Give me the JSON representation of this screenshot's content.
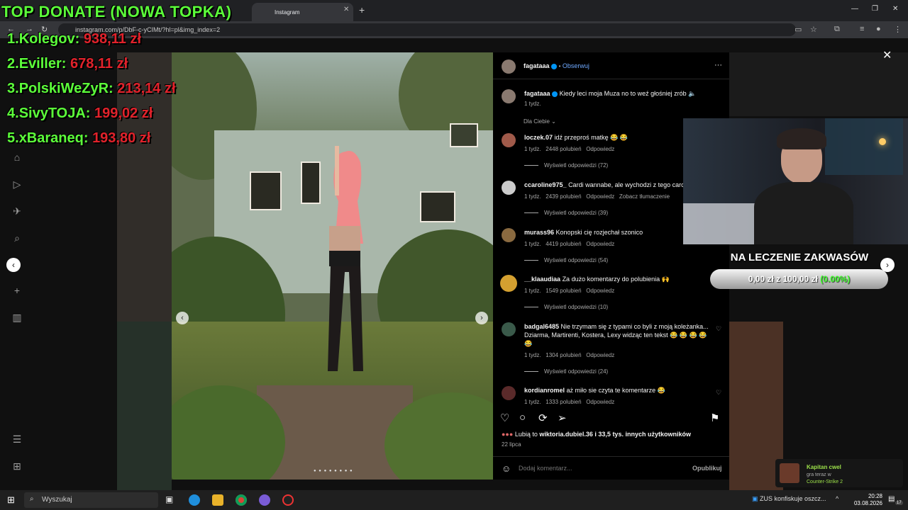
{
  "browser": {
    "tabs": [
      {
        "label": "Instagram"
      }
    ],
    "url": "instagram.com/p/DbF-c-yCIMt/?hl=pl&img_index=2",
    "new_tab": "+",
    "window_controls": [
      "—",
      "❐",
      "✕"
    ]
  },
  "overlay": {
    "title": "TOP DONATE (NOWA TOPKA)",
    "donors": [
      {
        "rank": "1.",
        "name": "Kolegov:",
        "amount": "938,11 zł"
      },
      {
        "rank": "2.",
        "name": "Eviller:",
        "amount": "678,11 zł"
      },
      {
        "rank": "3.",
        "name": "PolskiWeZyR:",
        "amount": "213,14 zł"
      },
      {
        "rank": "4.",
        "name": "SivyTOJA:",
        "amount": "199,02 zł"
      },
      {
        "rank": "5.",
        "name": "xBaraneq:",
        "amount": "193,80 zł"
      }
    ],
    "goal": {
      "title": "NA LECZENIE ZAKWASÓW",
      "amount_text": "0,00 zł z 100,00 zł",
      "percent_text": "(0.00%)",
      "progress": 0
    }
  },
  "post": {
    "author": "fagataaa",
    "follow": "Obserwuj",
    "more": "···",
    "caption": "Kiedy leci moja Muza no to weź głośniej zrób 🔈",
    "caption_time": "1 tydz.",
    "filter": "Dla Ciebie ⌄",
    "comments": [
      {
        "user": "loczek.07",
        "text": "idź przeproś matkę 😂 😂",
        "time": "1 tydz.",
        "likes": "2448 polubień",
        "reply": "Odpowiedz",
        "translate": "",
        "replies": "Wyświetl odpowiedzi (72)"
      },
      {
        "user": "ccaroline975_",
        "text": "Cardi wannabe, ale wychodzi z tego carc",
        "time": "1 tydz.",
        "likes": "2439 polubień",
        "reply": "Odpowiedz",
        "translate": "Zobacz tłumaczenie",
        "replies": "Wyświetl odpowiedzi (39)"
      },
      {
        "user": "murass96",
        "text": "Konopski cię rozjechał szonico",
        "time": "1 tydz.",
        "likes": "4419 polubień",
        "reply": "Odpowiedz",
        "translate": "",
        "replies": "Wyświetl odpowiedzi (54)"
      },
      {
        "user": "__klaaudiaa",
        "text": "Za dużo komentarzy do polubienia 🙌",
        "time": "1 tydz.",
        "likes": "1549 polubień",
        "reply": "Odpowiedz",
        "translate": "",
        "replies": "Wyświetl odpowiedzi (10)"
      },
      {
        "user": "badgal6485",
        "text": "Nie trzymam się z typami co byli z moją koleżanka... Dziarma, Martirenti, Kostera, Lexy widząc ten tekst 😂 😂 😂 😂 😂",
        "time": "1 tydz.",
        "likes": "1304 polubień",
        "reply": "Odpowiedz",
        "translate": "",
        "replies": "Wyświetl odpowiedzi (24)"
      },
      {
        "user": "kordianromel",
        "text": "aż miło sie czyta te komentarze 😂",
        "time": "1 tydz.",
        "likes": "1333 polubień",
        "reply": "Odpowiedz",
        "translate": "",
        "replies": ""
      }
    ],
    "likes_prefix": "Lubią to",
    "likes_user": "wiktoria.dubiel.36",
    "likes_suffix": "i 33,5 tys. innych użytkowników",
    "date": "22 lipca",
    "add_comment_placeholder": "Dodaj komentarz...",
    "publish": "Opublikuj"
  },
  "notification": {
    "name": "Kapitan cwel",
    "line1": "gra teraz w",
    "line2": "Counter-Strike 2"
  },
  "taskbar": {
    "search": "Wyszukaj",
    "news": "ZUS konfiskuje oszcz...",
    "time": "20:28",
    "date": "03.08.2026",
    "badge": "17"
  },
  "colors": {
    "donate_green": "#5cff3a",
    "donate_red": "#e1222b",
    "ig_blue": "#6ea8fe"
  }
}
